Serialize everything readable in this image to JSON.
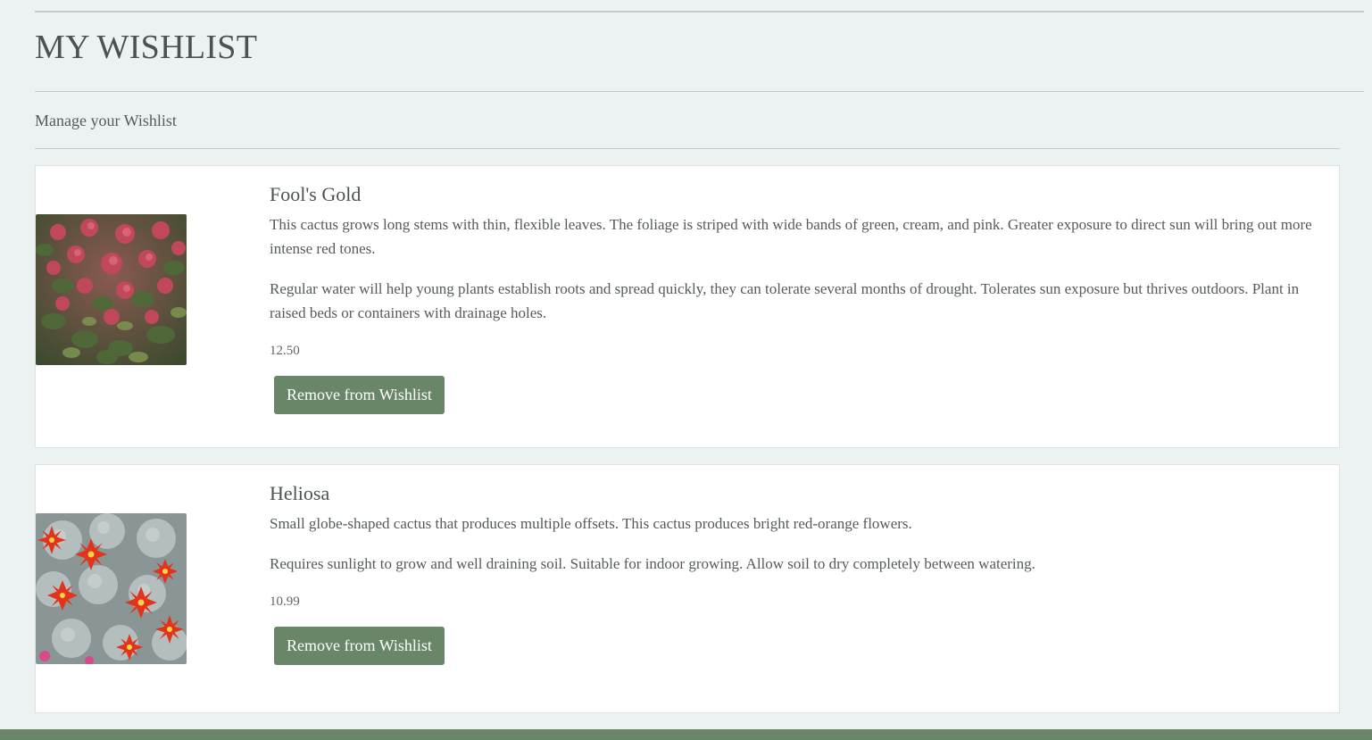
{
  "page": {
    "title": "MY WISHLIST",
    "subtitle": "Manage your Wishlist"
  },
  "colors": {
    "background": "#ecf2f2",
    "card": "#ffffff",
    "button": "#6a8669",
    "footer": "#6a8669",
    "text": "#555b5b"
  },
  "wishlist": [
    {
      "name": "Fool's Gold",
      "description": "This cactus grows long stems with thin, flexible leaves. The foliage is striped with wide bands of green, cream, and pink. Greater exposure to direct sun will bring out more intense red tones.",
      "care": "Regular water will help young plants establish roots and spread quickly, they can tolerate several months of drought. Tolerates sun exposure but thrives outdoors. Plant in raised beds or containers with drainage holes.",
      "price": "12.50",
      "button_label": "Remove from Wishlist",
      "image": "succulent-groundcover-photo"
    },
    {
      "name": "Heliosa",
      "description": "Small globe-shaped cactus that produces multiple offsets. This cactus produces bright red-orange flowers.",
      "care": "Requires sunlight to grow and well draining soil. Suitable for indoor growing. Allow soil to dry completely between watering.",
      "price": "10.99",
      "button_label": "Remove from Wishlist",
      "image": "flowering-cactus-photo"
    }
  ]
}
